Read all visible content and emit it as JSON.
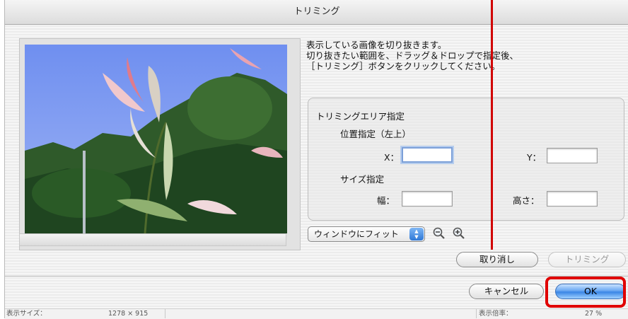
{
  "dialog": {
    "title": "トリミング"
  },
  "instructions": [
    "表示している画像を切り抜きます。",
    "切り抜きたい範囲を、ドラッグ＆ドロップで指定後、",
    "［トリミング］ボタンをクリックしてください。"
  ],
  "trim_area": {
    "group_title": "トリミングエリア指定",
    "position_label": "位置指定（左上）",
    "x_label": "X：",
    "y_label": "Y：",
    "x_value": "",
    "y_value": "",
    "size_label": "サイズ指定",
    "width_label": "幅：",
    "height_label": "高さ：",
    "width_value": "",
    "height_value": ""
  },
  "view_popup": {
    "selected": "ウィンドウにフィット"
  },
  "buttons": {
    "undo": "取り消し",
    "trim": "トリミング",
    "cancel": "キャンセル",
    "ok": "OK"
  },
  "status": {
    "display_size_label": "表示サイズ：",
    "display_size_value": "1278 × 915",
    "zoom_label": "表示倍率：",
    "zoom_value": "27 %"
  },
  "colors": {
    "highlight": "#e00000",
    "ok_button": "#3a86e6"
  },
  "icons": [
    "zoom-out-icon",
    "zoom-in-icon",
    "popup-arrows-icon"
  ]
}
